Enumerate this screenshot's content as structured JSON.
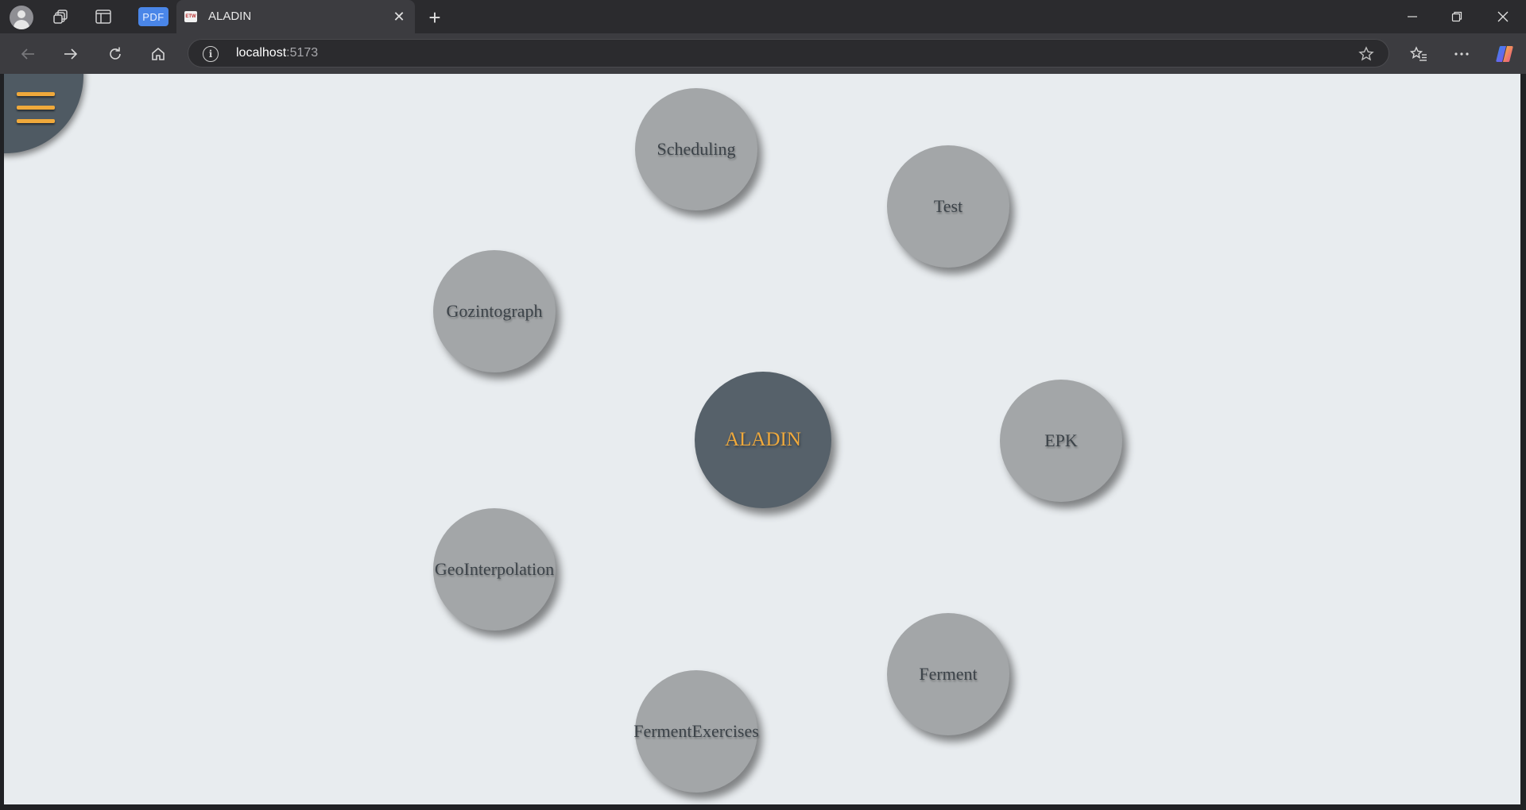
{
  "browser": {
    "pdf_badge": "PDF",
    "tab": {
      "favicon": "ETW",
      "title": "ALADIN",
      "close": "✕"
    },
    "new_tab": "+",
    "window": {
      "minimize": "—",
      "restore": "❐",
      "close": "✕"
    },
    "address": {
      "host": "localhost",
      "port": ":5173"
    }
  },
  "app": {
    "center_node": "ALADIN",
    "nodes": {
      "scheduling": "Scheduling",
      "test": "Test",
      "gozintograph": "Gozintograph",
      "epk": "EPK",
      "geointerpolation": "GeoInterpolation",
      "ferment": "Ferment",
      "fermentexercises": "FermentExercises"
    },
    "colors": {
      "accent": "#f0a93b",
      "center_fill": "#56616a",
      "node_fill": "#a3a6a8",
      "background": "#e8ecef"
    }
  }
}
